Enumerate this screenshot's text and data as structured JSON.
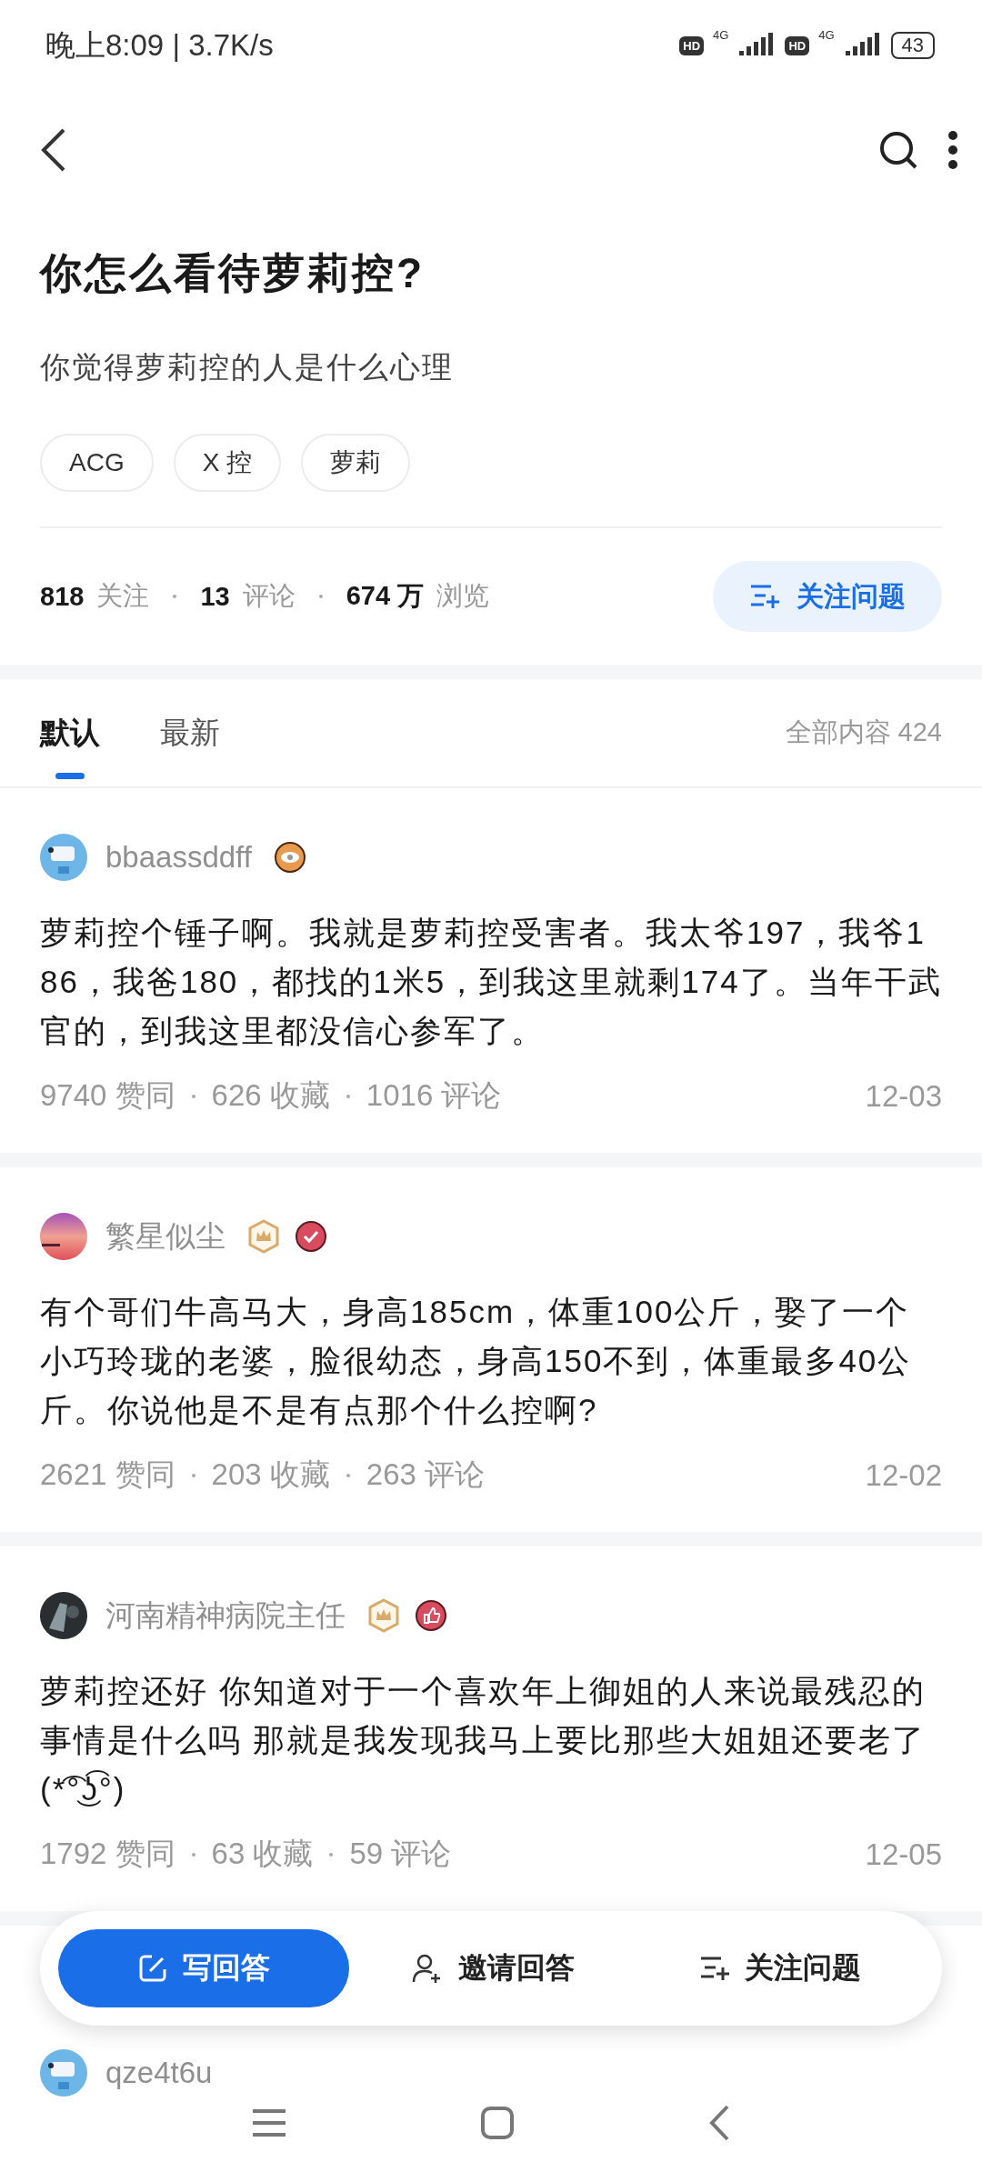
{
  "status_bar": {
    "time": "晚上8:09 | 3.7K/s",
    "sims": [
      {
        "hd": "HD",
        "network": "4G"
      },
      {
        "hd": "HD",
        "network": "4G"
      }
    ],
    "battery": "43"
  },
  "question": {
    "title": "你怎么看待萝莉控?",
    "description": "你觉得萝莉控的人是什么心理",
    "tags": [
      "ACG",
      "X 控",
      "萝莉"
    ],
    "stats": [
      {
        "count": "818",
        "label": "关注"
      },
      {
        "count": "13",
        "label": "评论"
      },
      {
        "count": "674 万",
        "label": "浏览"
      }
    ],
    "follow_button": "关注问题"
  },
  "tabs": [
    {
      "label": "默认",
      "selected": true
    },
    {
      "label": "最新",
      "selected": false
    }
  ],
  "total": "全部内容 424",
  "answers": [
    {
      "author": "bbaassddff",
      "avatar": {
        "kind": "dog"
      },
      "badges": [
        {
          "kind": "eye"
        }
      ],
      "text": "萝莉控个锤子啊。我就是萝莉控受害者。我太爷197，我爷186，我爸180，都找的1米5，到我这里就剩174了。当年干武官的，到我这里都没信心参军了。",
      "meta": [
        "9740 赞同",
        "626 收藏",
        "1016 评论"
      ],
      "date": "12-03"
    },
    {
      "author": "繁星似尘",
      "avatar": {
        "kind": "sunset"
      },
      "badges": [
        {
          "kind": "crown"
        },
        {
          "kind": "check"
        }
      ],
      "text": "有个哥们牛高马大，身高185cm，体重100公斤，娶了一个小巧玲珑的老婆，脸很幼态，身高150不到，体重最多40公斤。你说他是不是有点那个什么控啊?",
      "meta": [
        "2621 赞同",
        "203 收藏",
        "263 评论"
      ],
      "date": "12-02"
    },
    {
      "author": "河南精神病院主任",
      "avatar": {
        "kind": "dark"
      },
      "badges": [
        {
          "kind": "crown"
        },
        {
          "kind": "thumb"
        }
      ],
      "text": "萝莉控还好 你知道对于一个喜欢年上御姐的人来说最残忍的事情是什么吗 那就是我发现我马上要比那些大姐姐还要老了 (*͡°͜ʖ͡°)",
      "meta": [
        "1792 赞同",
        "63 收藏",
        "59 评论"
      ],
      "date": "12-05"
    },
    {
      "author": "qze4t6u",
      "avatar": {
        "kind": "dog"
      }
    }
  ],
  "action_bar": [
    {
      "kind": "write",
      "label": "写回答"
    },
    {
      "kind": "invite",
      "label": "邀请回答"
    },
    {
      "kind": "follow",
      "label": "关注问题"
    }
  ]
}
